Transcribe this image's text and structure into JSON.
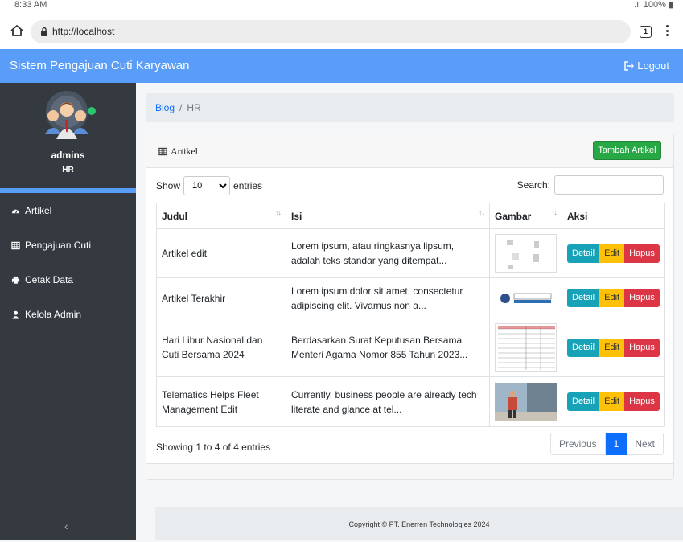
{
  "status": {
    "time": "8:33 AM",
    "battery": "100%"
  },
  "browser": {
    "url": "http://localhost",
    "tab_count": "1"
  },
  "navbar": {
    "brand": "Sistem Pengajuan Cuti Karyawan",
    "logout": "Logout"
  },
  "sidebar": {
    "username": "admins",
    "role": "HR",
    "items": [
      {
        "label": "Artikel",
        "icon": "dashboard-icon"
      },
      {
        "label": "Pengajuan Cuti",
        "icon": "table-icon"
      },
      {
        "label": "Cetak Data",
        "icon": "print-icon"
      },
      {
        "label": "Kelola Admin",
        "icon": "user-icon"
      }
    ]
  },
  "breadcrumb": {
    "home": "Blog",
    "current": "HR"
  },
  "card": {
    "title": "Artikel",
    "add_button": "Tambah Artikel",
    "show_label": "Show",
    "entries_value": "10",
    "entries_label": "entries",
    "search_label": "Search:",
    "columns": [
      "Judul",
      "Isi",
      "Gambar",
      "Aksi"
    ],
    "rows": [
      {
        "judul": "Artikel edit",
        "isi": "Lorem ipsum, atau ringkasnya lipsum, adalah teks standar yang ditempat..."
      },
      {
        "judul": "Artikel Terakhir",
        "isi": "Lorem ipsum dolor sit amet, consectetur adipiscing elit. Vivamus non a..."
      },
      {
        "judul": "Hari Libur Nasional dan Cuti Bersama 2024",
        "isi": "Berdasarkan Surat Keputusan Bersama Menteri Agama Nomor 855 Tahun 2023..."
      },
      {
        "judul": "Telematics Helps Fleet Management Edit",
        "isi": "Currently, business people are already tech literate and glance at tel..."
      }
    ],
    "actions": {
      "detail": "Detail",
      "edit": "Edit",
      "hapus": "Hapus"
    },
    "info": "Showing 1 to 4 of 4 entries",
    "pager": {
      "prev": "Previous",
      "current": "1",
      "next": "Next"
    }
  },
  "footer": "Copyright © PT. Enerren Technologies 2024",
  "colors": {
    "navbar": "#5a9df8",
    "sidebar": "#343a40",
    "success": "#28a745",
    "info": "#17a2b8",
    "warning": "#ffc107",
    "danger": "#dc3545"
  }
}
